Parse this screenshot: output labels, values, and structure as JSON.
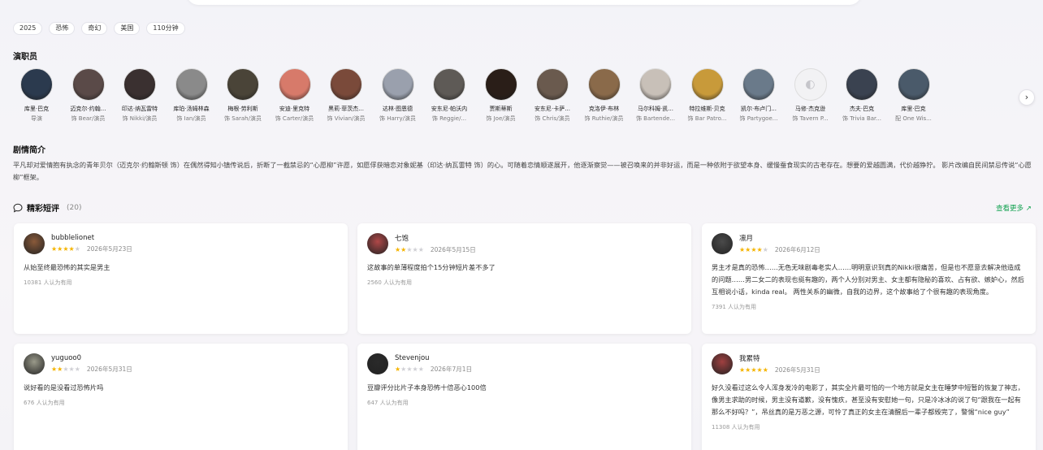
{
  "tags": [
    "2025",
    "恐怖",
    "奇幻",
    "美国",
    "110分钟"
  ],
  "cast_section": {
    "title": "演职员"
  },
  "cast": [
    {
      "name": "库里·巴克",
      "role": "导演",
      "color": "#2b3a4e"
    },
    {
      "name": "迈克尔·约翰...",
      "role": "饰 Bear/演员",
      "color": "#5a4a48"
    },
    {
      "name": "印达·纳瓦雷特",
      "role": "饰 Nikki/演员",
      "color": "#3a3030"
    },
    {
      "name": "库珀·汤姆林森",
      "role": "饰 Ian/演员",
      "color": "#8a8a8a"
    },
    {
      "name": "梅根·劳利斯",
      "role": "饰 Sarah/演员",
      "color": "#4a4438"
    },
    {
      "name": "安迪·里克特",
      "role": "饰 Carter/演员",
      "color": "#d77a6a"
    },
    {
      "name": "黑莉·菲茨杰...",
      "role": "饰 Vivian/演员",
      "color": "#7a4a3a"
    },
    {
      "name": "达林·图恩德",
      "role": "饰 Harry/演员",
      "color": "#9aa0ad"
    },
    {
      "name": "安东尼·帕沃内",
      "role": "饰 Reggie/...",
      "color": "#5e5a56"
    },
    {
      "name": "贾斯蒂斯",
      "role": "饰 Joe/演员",
      "color": "#2a1e18"
    },
    {
      "name": "安东尼·卡萨...",
      "role": "饰 Chris/演员",
      "color": "#6a5a4e"
    },
    {
      "name": "克洛伊·布林",
      "role": "饰 Ruthie/演员",
      "color": "#8a6a4a"
    },
    {
      "name": "马尔科姆·凯...",
      "role": "饰 Bartende...",
      "color": "#c8c0b8"
    },
    {
      "name": "特拉维斯·贝克",
      "role": "饰 Bar Patro...",
      "color": "#c89a3a"
    },
    {
      "name": "凯尔·布卢门...",
      "role": "饰 Partygoe...",
      "color": "#6a7a8a"
    },
    {
      "name": "马修·杰克逊",
      "role": "饰 Tavern P...",
      "color": ""
    },
    {
      "name": "杰夫·巴克",
      "role": "饰 Trivia Bar...",
      "color": "#3a4250"
    },
    {
      "name": "库里·巴克",
      "role": "配 One Wis...",
      "color": "#4a5a6a"
    }
  ],
  "synopsis": {
    "title": "剧情简介",
    "text": "平凡却对爱情抱有执念的青年贝尔（迈克尔·约翰斯顿 饰）在偶然得知小镇传说后，折断了一截禁忌的“心愿柳”许愿，如愿俘获暗恋对象妮基（印达·纳瓦雷特 饰）的心。可随着恋情顺遂展开，他逐渐察觉——被召唤来的并非好运，而是一种依附于欲望本身、缓慢蚕食现实的古老存在。想要的爱越圆满，代价越狰狞。 影片改编自民间禁忌传说“心愿柳”框架。"
  },
  "reviews_section": {
    "title": "精彩短评",
    "count": "(20)",
    "more_label": "查看更多"
  },
  "reviews": [
    {
      "user": "bubblelionet",
      "stars": 4,
      "date": "2026年5月23日",
      "text": "从始至终最恐怖的其实是男主",
      "helpful": "10381 人认为有用",
      "avatar_color": "#8a5a3a"
    },
    {
      "user": "七饱",
      "stars": 2,
      "date": "2026年5月15日",
      "text": "这故事的单薄程度拍个15分钟短片差不多了",
      "helpful": "2560 人认为有用",
      "avatar_color": "#b04848"
    },
    {
      "user": "凛月",
      "stars": 4,
      "date": "2026年6月12日",
      "text": "男主才是真的恐怖……无色无味剧毒老实人……明明意识到真的Nikki很痛苦，但是也不愿意去解决他造成的问题……男二女二的表现也挺有趣的，两个人分别对男主、女主都有隐秘的喜欢、占有欲、嫉妒心，然后互相说小话，kinda real。 两性关系的幽微，自我的边界，这个故事给了个很有趣的表现角度。",
      "helpful": "7391 人认为有用",
      "avatar_color": "#4a4a4a"
    },
    {
      "user": "yuguoo0",
      "stars": 2,
      "date": "2026年5月31日",
      "text": "说好看的是没看过恐怖片吗",
      "helpful": "676 人认为有用",
      "avatar_color": "#9a9a8a"
    },
    {
      "user": "Stevenjou",
      "stars": 1,
      "date": "2026年7月1日",
      "text": "豆瓣评分比片子本身恐怖十倍恶心100倍",
      "helpful": "647 人认为有用",
      "avatar_color": "#2a2a2a"
    },
    {
      "user": "我累特",
      "stars": 5,
      "date": "2026年5月31日",
      "text": "好久没看过这么令人浑身发冷的电影了，其实全片最可怕的一个地方就是女主在睡梦中短暂的恢复了神志，像男主求助的时候，男主没有道歉，没有愧疚，甚至没有安慰她一句，只是冷冰冰的说了句“跟我在一起有那么不好吗？”，吊丝真的是万恶之源，可怜了真正的女主在清醒后一辈子都毁完了，警惕“nice guy”",
      "helpful": "11308 人认为有用",
      "avatar_color": "#a04040"
    }
  ]
}
